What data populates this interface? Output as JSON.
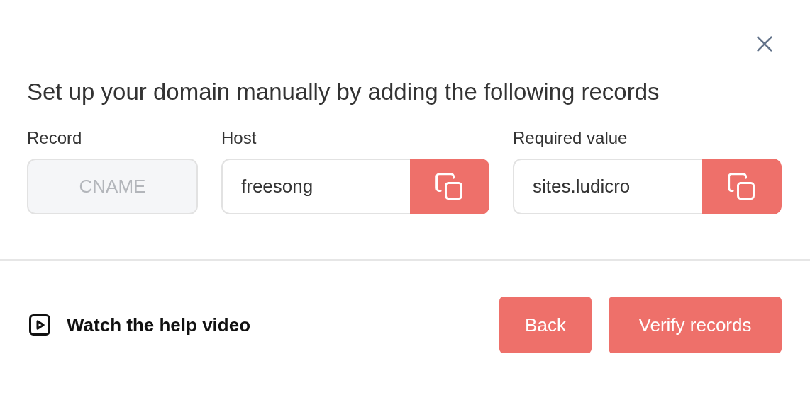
{
  "dialog": {
    "title": "Set up your domain manually by adding the following records",
    "fields": [
      {
        "label": "Record",
        "value": "CNAME",
        "disabled": true,
        "copy": false
      },
      {
        "label": "Host",
        "value": "freesong",
        "disabled": false,
        "copy": true
      },
      {
        "label": "Required value",
        "value": "sites.ludicro",
        "disabled": false,
        "copy": true
      }
    ],
    "help_link": "Watch the help video",
    "buttons": [
      "Back",
      "Verify records"
    ]
  }
}
